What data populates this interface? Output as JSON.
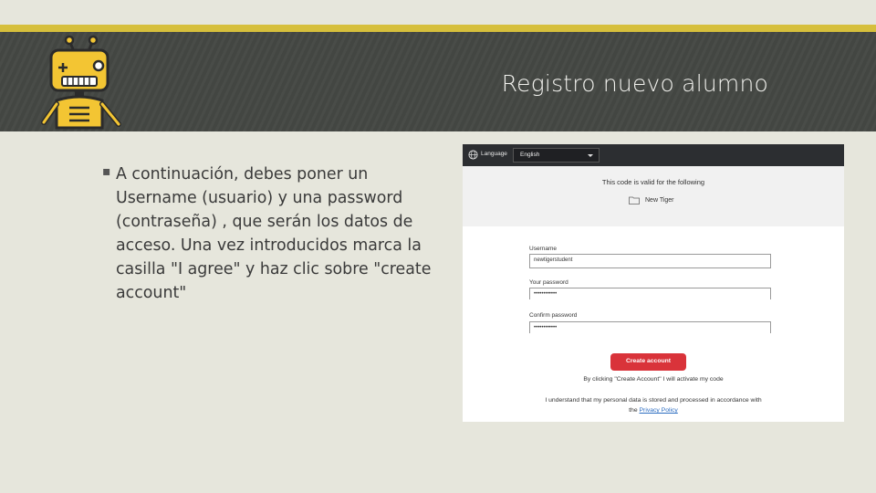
{
  "slide": {
    "title": "Registro nuevo alumno",
    "bullet": "A continuación, debes poner un Username (usuario) y una password (contraseña) , que serán los datos de acceso. Una vez introducidos marca la casilla \"I agree\" y haz clic sobre \"create account\""
  },
  "colors": {
    "accent_stripe": "#d6bf3c",
    "header_band": "#454844",
    "background": "#e6e6dc",
    "button_red": "#d9333a",
    "link_blue": "#2b6cc0"
  },
  "screenshot": {
    "language_label": "Language",
    "language_value": "English",
    "valid_text": "This code is valid for the following",
    "product_name": "New Tiger",
    "username_label": "Username",
    "username_value": "newtigerstudent",
    "password_label": "Your password",
    "password_value": "••••••••••••",
    "confirm_label": "Confirm password",
    "confirm_value": "••••••••••••",
    "create_button": "Create account",
    "activation_note": "By clicking \"Create Account\" I will activate my code",
    "privacy_note_line1": "I understand that my personal data is stored and processed in accordance with",
    "privacy_note_prefix": "the",
    "privacy_link": "Privacy Policy"
  }
}
